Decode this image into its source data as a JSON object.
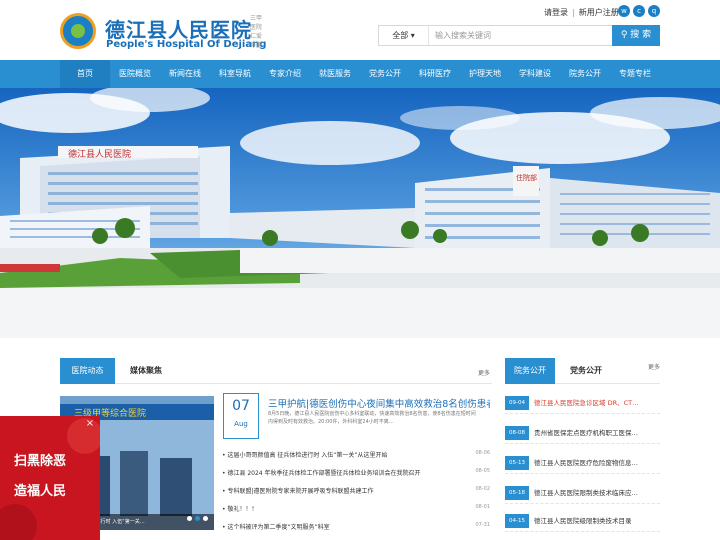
{
  "header": {
    "name_cn": "德江县人民医院",
    "name_en": "People's Hospital Of Dejiang",
    "motto": "三甲 医院 仁爱 尊重",
    "login": "请登录",
    "register": "新用户注册",
    "social_icons": [
      "weibo-icon",
      "wechat-icon",
      "qq-icon"
    ]
  },
  "search": {
    "scope": "全部",
    "placeholder": "输入搜索关键词",
    "button": "搜 索"
  },
  "nav": [
    "首页",
    "医院概览",
    "新闻在线",
    "科室导航",
    "专家介绍",
    "就医服务",
    "党务公开",
    "科研医疗",
    "护理天地",
    "学科建设",
    "院务公开",
    "专题专栏"
  ],
  "banner": {
    "sign": "德江县人民医院",
    "sign2": "住院部"
  },
  "news": {
    "tab_active": "医院动态",
    "tab_other": "媒体聚焦",
    "more": "更多",
    "image_caption": "…高 征兵体检进行时 入伍“第一关…",
    "image_banner": "三级甲等综合医院",
    "featured": {
      "day": "07",
      "month": "Aug",
      "title": "三甲护航|德医创伤中心夜间集中高效救治8名创伤患者",
      "summary": "8月5日晚，德江县人民医院创伤中心多科室联动，快速高效救治8名伤患，使8名伤患在短时间内得到及时有效救治。20:00许，外科科室24小时不离…"
    },
    "items": [
      {
        "title": "• 这届小哥哥颜值高 征兵体检进行时 入伍“第一关”从这里开始",
        "date": "08-06"
      },
      {
        "title": "• 德江县 2024 年秋季征兵体检工作部署暨征兵体检业务培训会在我院召开",
        "date": "08-05"
      },
      {
        "title": "• 专科联盟|遵医附院专家来院开展呼吸专科联盟共建工作",
        "date": "08-02"
      },
      {
        "title": "• 敬礼！！！",
        "date": "08-01"
      },
      {
        "title": "• 这个科被评为第二季度“文明服务”科室",
        "date": "07-31"
      }
    ]
  },
  "affairs": {
    "tab_active": "院务公开",
    "tab_other": "党务公开",
    "more": "更多",
    "items": [
      {
        "date": "09-04",
        "title": "德江县人民医院急诊区域 DR、CT…"
      },
      {
        "date": "08-08",
        "title": "贵州省医保定点医疗机构职工医保…"
      },
      {
        "date": "05-13",
        "title": "德江县人民医院医疗危险废物信息…"
      },
      {
        "date": "05-18",
        "title": "德江县人民医院限制类技术临床应…"
      },
      {
        "date": "04-15",
        "title": "德江县人民医院级限制类技术目录"
      }
    ]
  },
  "float_ad": {
    "line1": "扫黑除恶",
    "line2": "造福人民",
    "close": "×"
  },
  "colors": {
    "primary": "#2a8fd0",
    "brand": "#1a6fb8",
    "alert": "#d83a2a",
    "ad_red": "#c8151f"
  }
}
